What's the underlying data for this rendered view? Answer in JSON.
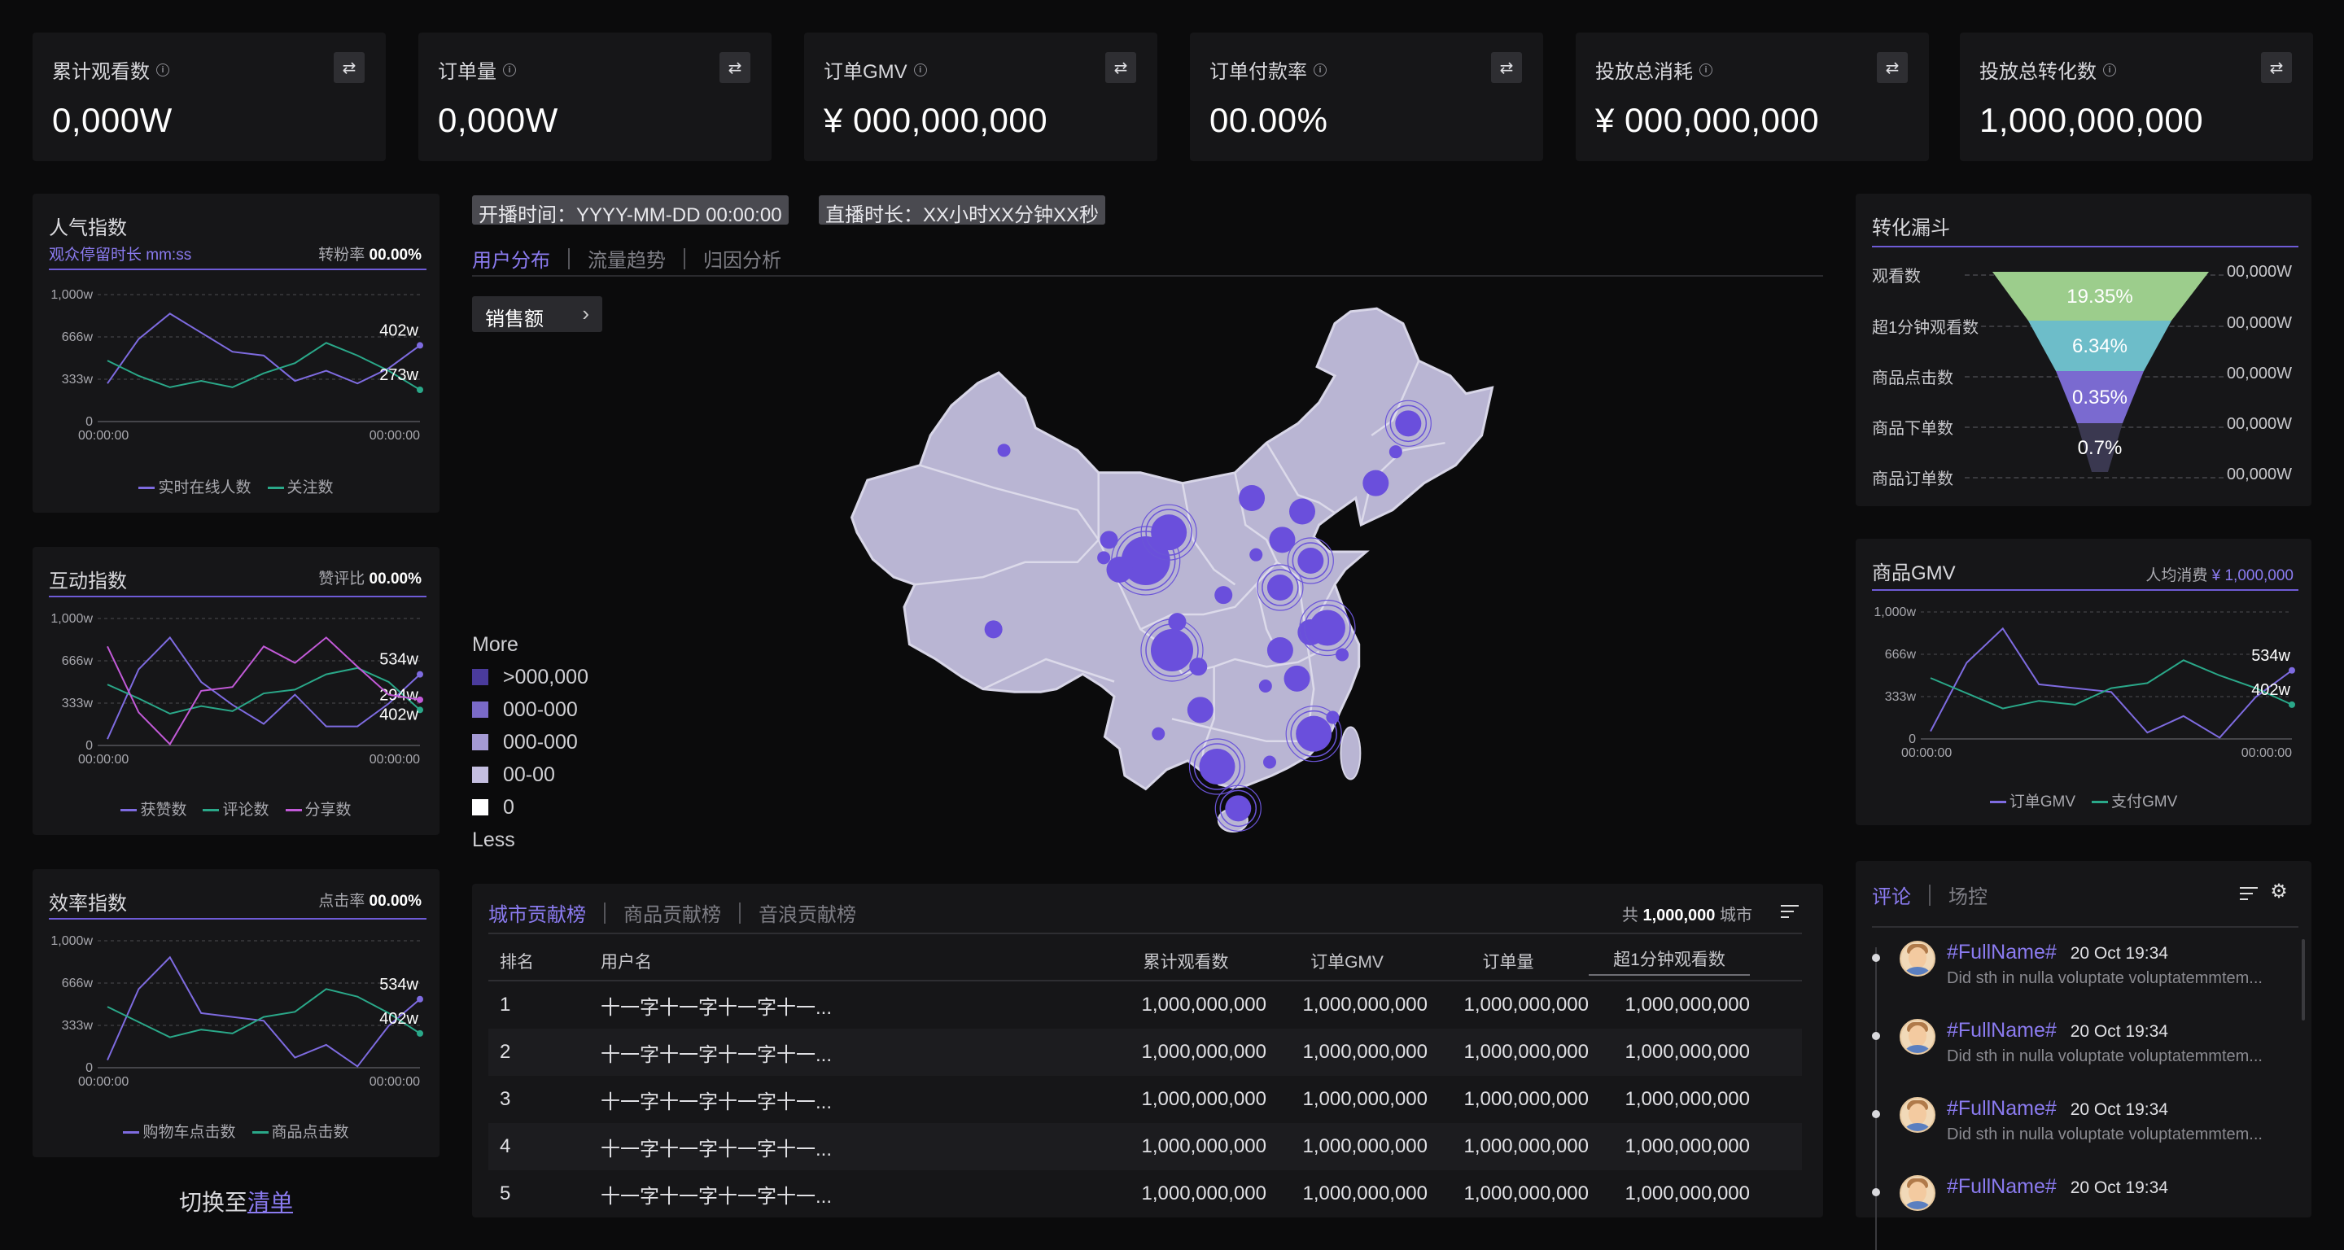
{
  "kpis": [
    {
      "label": "累计观看数",
      "value": "0,000W"
    },
    {
      "label": "订单量",
      "value": "0,000W"
    },
    {
      "label": "订单GMV",
      "value": "¥ 000,000,000"
    },
    {
      "label": "订单付款率",
      "value": "00.00%"
    },
    {
      "label": "投放总消耗",
      "value": "¥ 000,000,000"
    },
    {
      "label": "投放总转化数",
      "value": "1,000,000,000"
    }
  ],
  "panels": {
    "popularity": {
      "title": "人气指数",
      "sub_left": "观众停留时长 mm:ss",
      "sub_label": "转粉率",
      "sub_value": "00.00%",
      "legend": [
        "实时在线人数",
        "关注数"
      ],
      "chart_data": {
        "type": "line",
        "yticks": [
          "1,000w",
          "666w",
          "333w",
          "0"
        ],
        "ylim": [
          0,
          1000
        ],
        "xticks": [
          "00:00:00",
          "00:00:00"
        ],
        "series": [
          {
            "name": "实时在线人数",
            "color": "#7e6be0",
            "values": [
              300,
              650,
              850,
              700,
              550,
              520,
              320,
              400,
              300,
              420,
              600
            ],
            "end_label": "402w"
          },
          {
            "name": "关注数",
            "color": "#2aa889",
            "values": [
              480,
              360,
              270,
              320,
              270,
              380,
              460,
              620,
              520,
              400,
              250
            ],
            "end_label": "273w"
          }
        ]
      }
    },
    "interaction": {
      "title": "互动指数",
      "sub_label": "赞评比",
      "sub_value": "00.00%",
      "legend": [
        "获赞数",
        "评论数",
        "分享数"
      ],
      "chart_data": {
        "type": "line",
        "yticks": [
          "1,000w",
          "666w",
          "333w",
          "0"
        ],
        "ylim": [
          0,
          1000
        ],
        "xticks": [
          "00:00:00",
          "00:00:00"
        ],
        "series": [
          {
            "name": "获赞数",
            "color": "#7e6be0",
            "values": [
              50,
              600,
              850,
              500,
              320,
              170,
              400,
              150,
              150,
              330,
              560
            ],
            "end_label": "534w"
          },
          {
            "name": "评论数",
            "color": "#2aa889",
            "values": [
              480,
              370,
              250,
              310,
              270,
              410,
              440,
              560,
              610,
              500,
              280
            ],
            "end_label": "294w"
          },
          {
            "name": "分享数",
            "color": "#c25ad8",
            "values": [
              780,
              260,
              10,
              430,
              460,
              780,
              650,
              850,
              620,
              400,
              360
            ],
            "end_label": "402w"
          }
        ]
      }
    },
    "efficiency": {
      "title": "效率指数",
      "sub_label": "点击率",
      "sub_value": "00.00%",
      "legend": [
        "购物车点击数",
        "商品点击数"
      ],
      "chart_data": {
        "type": "line",
        "yticks": [
          "1,000w",
          "666w",
          "333w",
          "0"
        ],
        "ylim": [
          0,
          1000
        ],
        "xticks": [
          "00:00:00",
          "00:00:00"
        ],
        "series": [
          {
            "name": "购物车点击数",
            "color": "#7e6be0",
            "values": [
              60,
              620,
              870,
              430,
              400,
              370,
              80,
              180,
              10,
              330,
              540
            ],
            "end_label": "534w"
          },
          {
            "name": "商品点击数",
            "color": "#2aa889",
            "values": [
              480,
              360,
              240,
              300,
              270,
              400,
              440,
              620,
              560,
              430,
              270
            ],
            "end_label": "402w"
          }
        ]
      }
    }
  },
  "live": {
    "start": "开播时间：YYYY-MM-DD 00:00:00",
    "duration": "直播时长：XX小时XX分钟XX秒"
  },
  "center_tabs": [
    "用户分布",
    "流量趋势",
    "归因分析"
  ],
  "sales_button": "销售额",
  "map_legend": {
    "top": "More",
    "bottom": "Less",
    "items": [
      {
        "label": ">000,000",
        "color": "#4a3b9c"
      },
      {
        "label": "000-000",
        "color": "#7a6ac8"
      },
      {
        "label": "000-000",
        "color": "#a49ad4"
      },
      {
        "label": "00-00",
        "color": "#c4bee0"
      },
      {
        "label": "0",
        "color": "#ffffff"
      }
    ]
  },
  "ranking": {
    "tabs": [
      "城市贡献榜",
      "商品贡献榜",
      "音浪贡献榜"
    ],
    "total_prefix": "共",
    "total_value": "1,000,000",
    "total_suffix": "城市",
    "headers": [
      "排名",
      "用户名",
      "累计观看数",
      "订单GMV",
      "订单量",
      "超1分钟观看数"
    ],
    "rows": [
      [
        "1",
        "十一字十一字十一字十一...",
        "1,000,000,000",
        "1,000,000,000",
        "1,000,000,000",
        "1,000,000,000"
      ],
      [
        "2",
        "十一字十一字十一字十一...",
        "1,000,000,000",
        "1,000,000,000",
        "1,000,000,000",
        "1,000,000,000"
      ],
      [
        "3",
        "十一字十一字十一字十一...",
        "1,000,000,000",
        "1,000,000,000",
        "1,000,000,000",
        "1,000,000,000"
      ],
      [
        "4",
        "十一字十一字十一字十一...",
        "1,000,000,000",
        "1,000,000,000",
        "1,000,000,000",
        "1,000,000,000"
      ],
      [
        "5",
        "十一字十一字十一字十一...",
        "1,000,000,000",
        "1,000,000,000",
        "1,000,000,000",
        "1,000,000,000"
      ]
    ]
  },
  "funnel": {
    "title": "转化漏斗",
    "labels": [
      "观看数",
      "超1分钟观看数",
      "商品点击数",
      "商品下单数",
      "商品订单数"
    ],
    "values": [
      "00,000W",
      "00,000W",
      "00,000W",
      "00,000W",
      "00,000W"
    ],
    "rates": [
      "19.35%",
      "6.34%",
      "0.35%",
      "0.7%"
    ]
  },
  "gmv": {
    "title": "商品GMV",
    "sub_label": "人均消费",
    "sub_value": "¥ 1,000,000",
    "legend": [
      "订单GMV",
      "支付GMV"
    ],
    "chart_data": {
      "type": "line",
      "yticks": [
        "1,000w",
        "666w",
        "333w",
        "0"
      ],
      "ylim": [
        0,
        1000
      ],
      "xticks": [
        "00:00:00",
        "00:00:00"
      ],
      "series": [
        {
          "name": "订单GMV",
          "color": "#7e6be0",
          "values": [
            60,
            600,
            870,
            430,
            400,
            370,
            50,
            180,
            10,
            330,
            540
          ],
          "end_label": "534w"
        },
        {
          "name": "支付GMV",
          "color": "#2aa889",
          "values": [
            480,
            360,
            240,
            300,
            270,
            400,
            440,
            620,
            500,
            400,
            270
          ],
          "end_label": "402w"
        }
      ]
    }
  },
  "comments": {
    "tabs": [
      "评论",
      "场控"
    ],
    "items": [
      {
        "name": "#FullName#",
        "time": "20 Oct  19:34",
        "text": "Did sth in nulla voluptate voluptatemmtem..."
      },
      {
        "name": "#FullName#",
        "time": "20 Oct  19:34",
        "text": "Did sth in nulla voluptate voluptatemmtem..."
      },
      {
        "name": "#FullName#",
        "time": "20 Oct  19:34",
        "text": "Did sth in nulla voluptate voluptatemmtem..."
      },
      {
        "name": "#FullName#",
        "time": "20 Oct  19:34",
        "text": ""
      }
    ]
  },
  "switch": {
    "prefix": "切换至",
    "link": "清单"
  },
  "map_bubbles": [
    {
      "lon": 88.0,
      "lat": 44.0,
      "v": 1
    },
    {
      "lon": 87.0,
      "lat": 32.0,
      "v": 2
    },
    {
      "lon": 98.0,
      "lat": 38.0,
      "v": 2
    },
    {
      "lon": 101.5,
      "lat": 36.6,
      "v": 6,
      "rings": true
    },
    {
      "lon": 103.7,
      "lat": 38.5,
      "v": 4,
      "rings": true
    },
    {
      "lon": 99.0,
      "lat": 36.0,
      "v": 3
    },
    {
      "lon": 97.5,
      "lat": 36.8,
      "v": 1
    },
    {
      "lon": 108.9,
      "lat": 34.3,
      "v": 2
    },
    {
      "lon": 111.6,
      "lat": 40.8,
      "v": 3
    },
    {
      "lon": 116.4,
      "lat": 39.9,
      "v": 3
    },
    {
      "lon": 114.5,
      "lat": 38.0,
      "v": 3
    },
    {
      "lon": 117.2,
      "lat": 36.6,
      "v": 3,
      "rings": true
    },
    {
      "lon": 114.3,
      "lat": 34.8,
      "v": 3,
      "rings": true
    },
    {
      "lon": 123.4,
      "lat": 41.8,
      "v": 3
    },
    {
      "lon": 126.5,
      "lat": 45.8,
      "v": 3,
      "rings": true
    },
    {
      "lon": 125.3,
      "lat": 43.9,
      "v": 1
    },
    {
      "lon": 112.0,
      "lat": 37.0,
      "v": 1
    },
    {
      "lon": 104.0,
      "lat": 30.6,
      "v": 5,
      "rings": true
    },
    {
      "lon": 106.5,
      "lat": 29.5,
      "v": 2
    },
    {
      "lon": 104.5,
      "lat": 32.5,
      "v": 2
    },
    {
      "lon": 114.3,
      "lat": 30.6,
      "v": 3
    },
    {
      "lon": 117.2,
      "lat": 31.8,
      "v": 3
    },
    {
      "lon": 118.8,
      "lat": 32.1,
      "v": 4,
      "rings": true
    },
    {
      "lon": 120.2,
      "lat": 30.3,
      "v": 1
    },
    {
      "lon": 112.9,
      "lat": 28.2,
      "v": 1
    },
    {
      "lon": 115.9,
      "lat": 28.7,
      "v": 3
    },
    {
      "lon": 106.7,
      "lat": 26.6,
      "v": 3
    },
    {
      "lon": 102.7,
      "lat": 25.0,
      "v": 1
    },
    {
      "lon": 108.3,
      "lat": 22.8,
      "v": 4,
      "rings": true
    },
    {
      "lon": 113.3,
      "lat": 23.1,
      "v": 1
    },
    {
      "lon": 119.3,
      "lat": 26.1,
      "v": 1
    },
    {
      "lon": 117.5,
      "lat": 25.0,
      "v": 4,
      "rings": true
    },
    {
      "lon": 110.3,
      "lat": 20.0,
      "v": 3,
      "rings": true
    }
  ]
}
